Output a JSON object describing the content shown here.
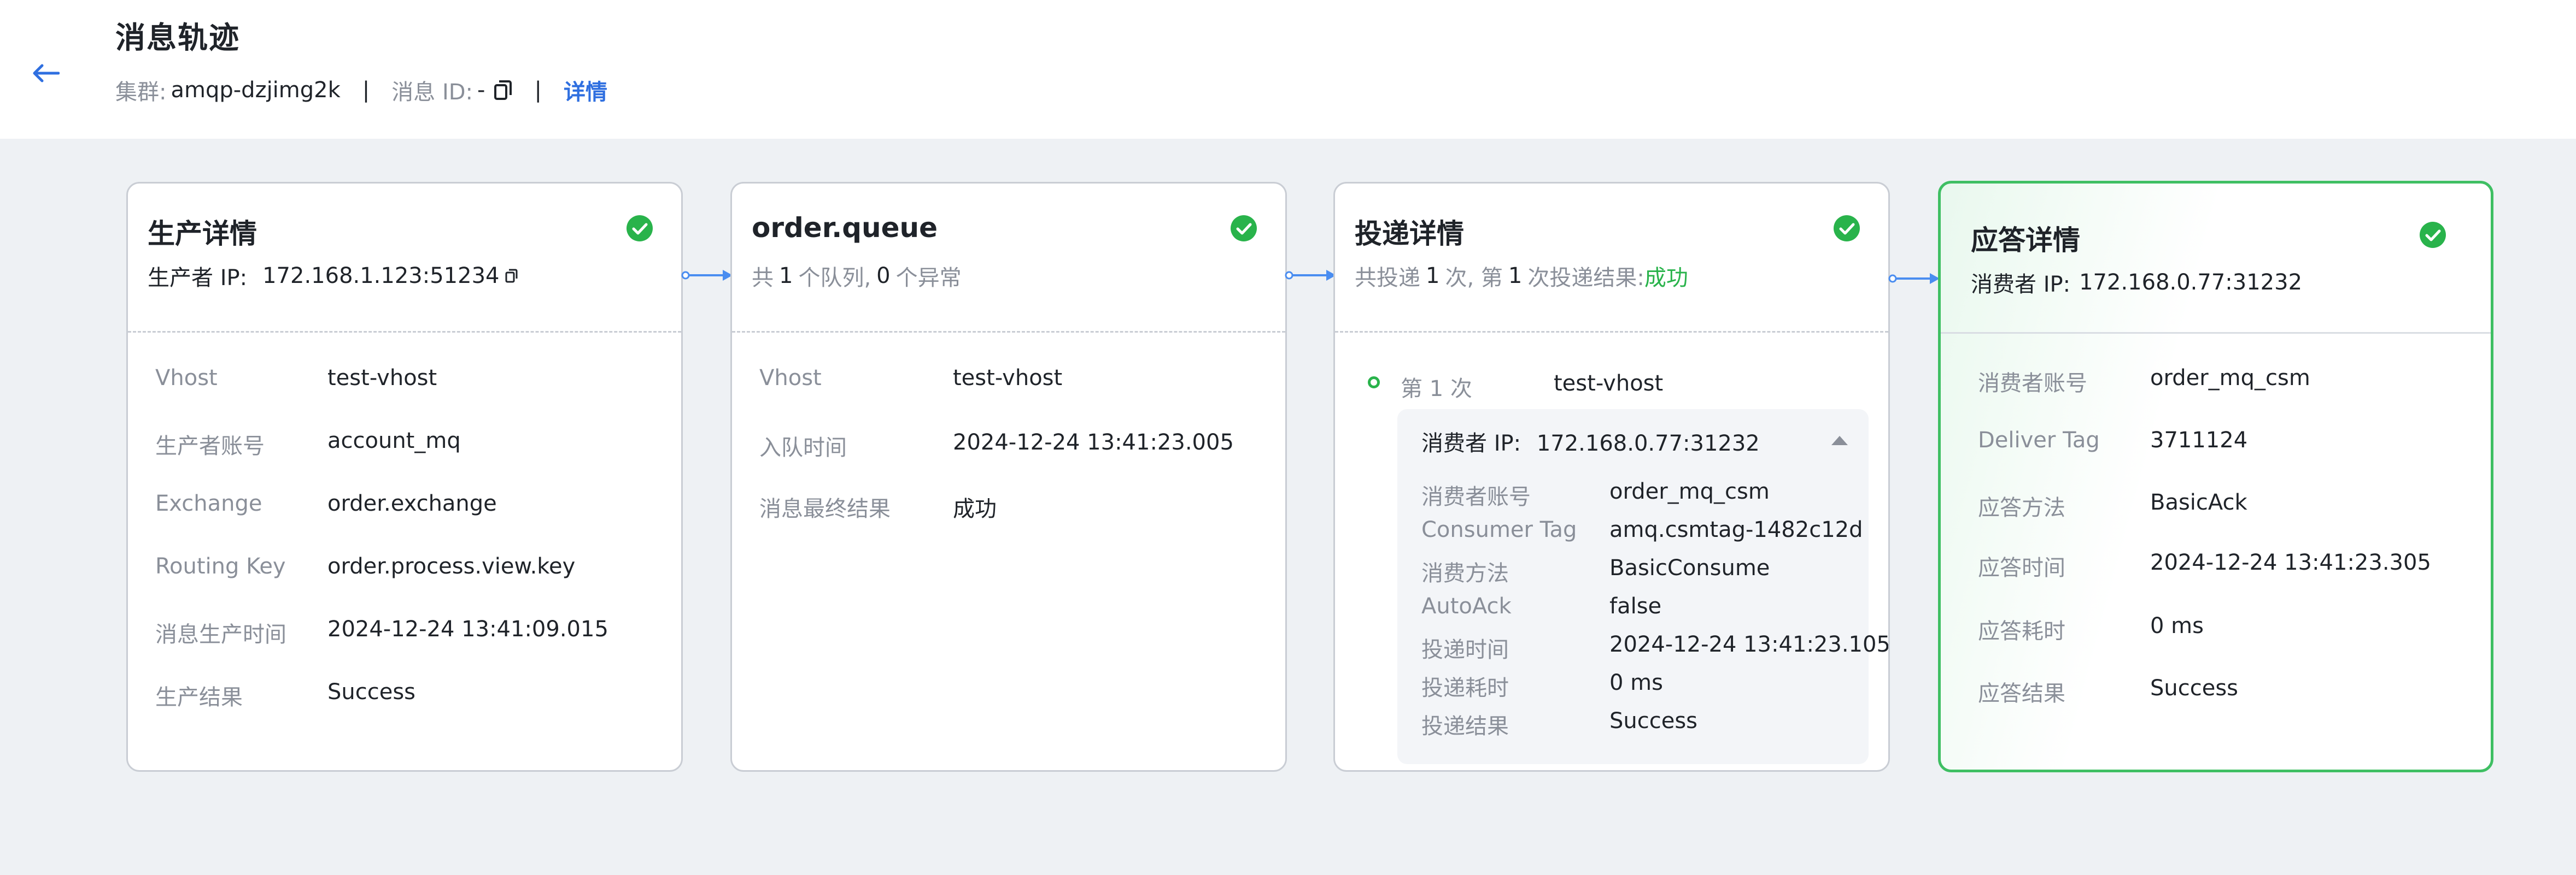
{
  "header": {
    "title": "消息轨迹",
    "cluster_label": "集群:",
    "cluster_value": "amqp-dzjimg2k",
    "separator": "|",
    "message_id_label": "消息 ID:",
    "message_id_value": "-",
    "details_link": "详情"
  },
  "producer": {
    "title": "生产详情",
    "ip_label": "生产者 IP:",
    "ip_value": "172.168.1.123:51234",
    "fields": [
      {
        "label": "Vhost",
        "value": "test-vhost"
      },
      {
        "label": "生产者账号",
        "value": "account_mq"
      },
      {
        "label": "Exchange",
        "value": "order.exchange"
      },
      {
        "label": "Routing Key",
        "value": "order.process.view.key"
      },
      {
        "label": "消息生产时间",
        "value": "2024-12-24 13:41:09.015"
      },
      {
        "label": "生产结果",
        "value": "Success"
      }
    ]
  },
  "queue": {
    "title": "order.queue",
    "summary_prefix": "共",
    "queue_count": "1",
    "summary_mid": "个队列,",
    "error_count": "0",
    "summary_suffix": "个异常",
    "fields": [
      {
        "label": "Vhost",
        "value": "test-vhost"
      },
      {
        "label": "入队时间",
        "value": "2024-12-24 13:41:23.005"
      },
      {
        "label": "消息最终结果",
        "value": "成功"
      }
    ]
  },
  "delivery": {
    "title": "投递详情",
    "summary_a": "共投递",
    "total_count": "1",
    "summary_b": "次, 第",
    "attempt_no": "1",
    "summary_c": "次投递结果:",
    "result": "成功",
    "attempt": {
      "label": "第 1 次",
      "vhost": "test-vhost",
      "consumer_ip_label": "消费者 IP:",
      "consumer_ip_value": "172.168.0.77:31232",
      "fields": [
        {
          "label": "消费者账号",
          "value": "order_mq_csm"
        },
        {
          "label": "Consumer Tag",
          "value": "amq.csmtag-1482c12d"
        },
        {
          "label": "消费方法",
          "value": "BasicConsume"
        },
        {
          "label": "AutoAck",
          "value": "false"
        },
        {
          "label": "投递时间",
          "value": "2024-12-24 13:41:23.105"
        },
        {
          "label": "投递耗时",
          "value": "0 ms"
        },
        {
          "label": "投递结果",
          "value": "Success"
        }
      ]
    }
  },
  "ack": {
    "title": "应答详情",
    "ip_label": "消费者 IP:",
    "ip_value": "172.168.0.77:31232",
    "fields": [
      {
        "label": "消费者账号",
        "value": "order_mq_csm"
      },
      {
        "label": "Deliver Tag",
        "value": "3711124"
      },
      {
        "label": "应答方法",
        "value": "BasicAck"
      },
      {
        "label": "应答时间",
        "value": "2024-12-24 13:41:23.305"
      },
      {
        "label": "应答耗时",
        "value": "0 ms"
      },
      {
        "label": "应答结果",
        "value": "Success"
      }
    ]
  },
  "colors": {
    "accent": "#2f6fe0",
    "success": "#29b34b",
    "border": "#c9cdd4",
    "muted": "#8a8f99"
  }
}
